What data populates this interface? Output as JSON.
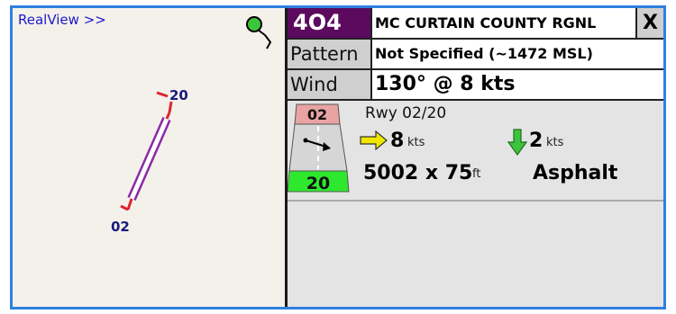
{
  "map": {
    "realview_label": "RealView >>",
    "runway_end_north": "20",
    "runway_end_south": "02"
  },
  "header": {
    "ident": "4O4",
    "airport_name": "MC CURTAIN COUNTY RGNL",
    "close_label": "X"
  },
  "info": {
    "pattern_label": "Pattern",
    "pattern_value": "Not Specified (~1472 MSL)",
    "wind_label": "Wind",
    "wind_value": "130° @ 8 kts"
  },
  "runway": {
    "name": "Rwy 02/20",
    "end_top": "02",
    "end_bottom": "20",
    "crosswind_value": "8",
    "crosswind_unit": "kts",
    "headwind_value": "2",
    "headwind_unit": "kts",
    "dimensions": "5002 x 75",
    "dimensions_unit": "ft",
    "surface": "Asphalt"
  },
  "colors": {
    "frame_border": "#2f80e0",
    "ident_bg": "#5b0a5e",
    "runway_purple": "#8a2aa8",
    "end_red": "#d9262c",
    "end_top_bg": "#e9a3a3",
    "end_bottom_bg": "#2ee82e",
    "crosswind_arrow": "#f2e600",
    "headwind_arrow": "#3cc43c",
    "position_dot": "#3cc43c"
  }
}
